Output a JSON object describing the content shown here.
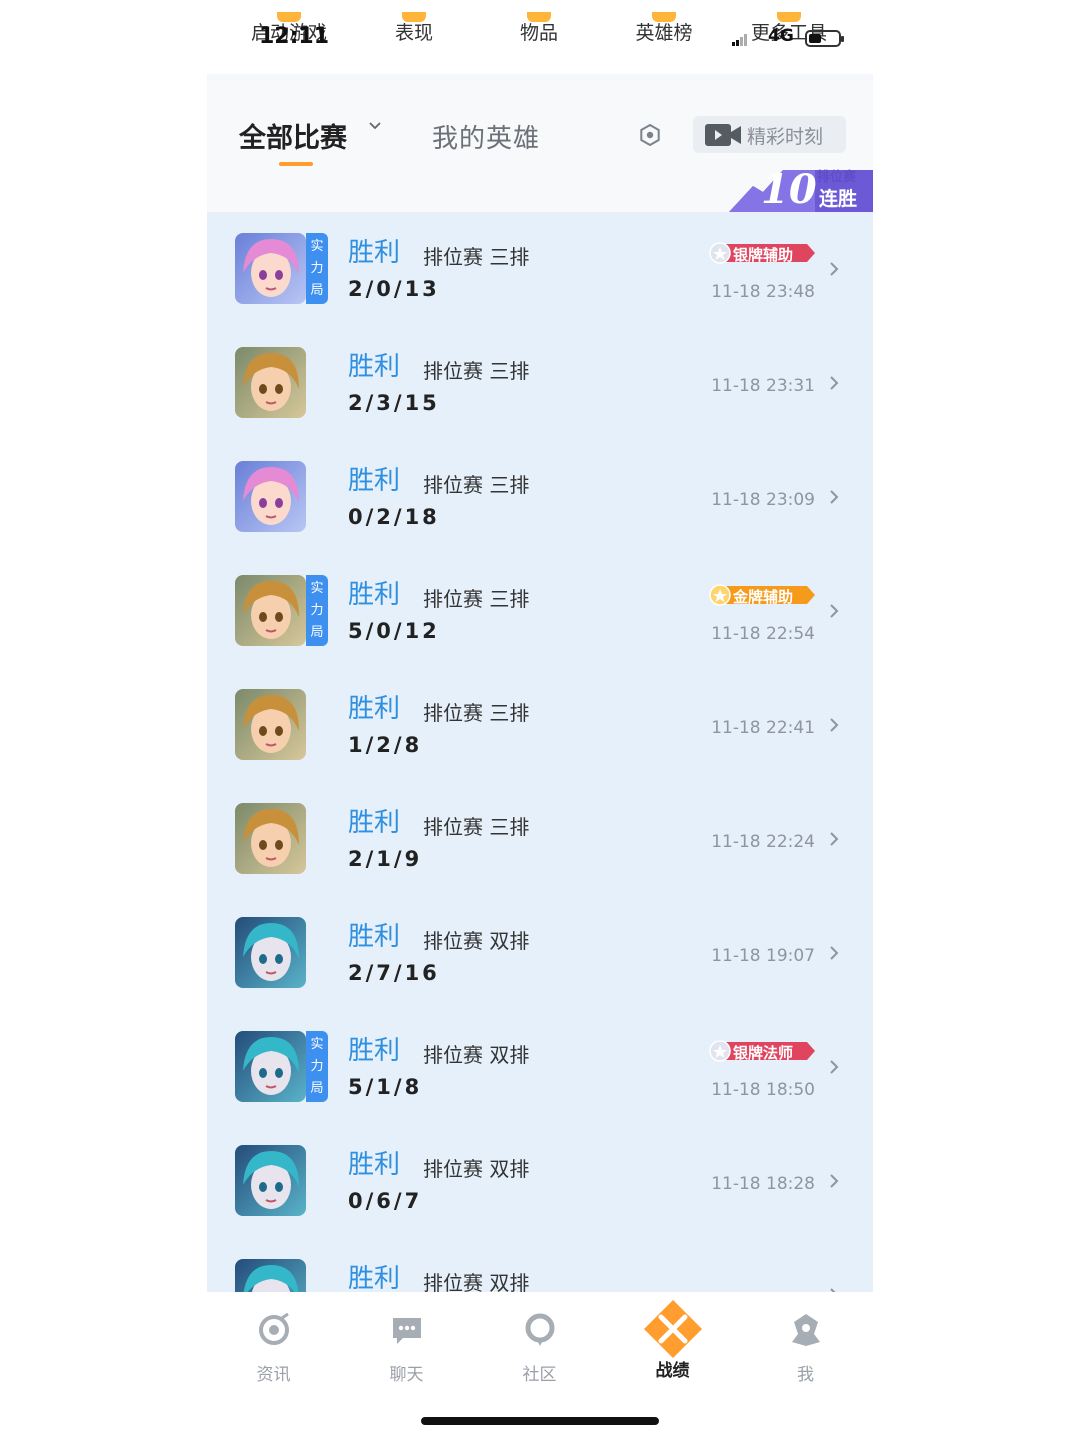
{
  "status_bar": {
    "time": "12:11",
    "network": "4G"
  },
  "top_nav": {
    "items": [
      {
        "label": "启动游戏"
      },
      {
        "label": "表现"
      },
      {
        "label": "物品"
      },
      {
        "label": "英雄榜"
      },
      {
        "label": "更多工具"
      }
    ],
    "accent": "#ffb43a"
  },
  "filter": {
    "all_matches": "全部比赛",
    "my_heroes": "我的英雄",
    "highlights": "精彩时刻",
    "streak": {
      "count": "10",
      "rank_label": "排位赛",
      "label": "连胜"
    }
  },
  "matches": [
    {
      "hero": "pink-hair-hero",
      "strength_tag": "实力局",
      "result": "胜利",
      "mode": "排位赛 三排",
      "kda": "2/0/13",
      "medal": "银牌辅助",
      "medal_tier": "silver",
      "time": "11-18 23:48"
    },
    {
      "hero": "blonde-hero",
      "strength_tag": "",
      "result": "胜利",
      "mode": "排位赛 三排",
      "kda": "2/3/15",
      "medal": "",
      "medal_tier": "",
      "time": "11-18 23:31"
    },
    {
      "hero": "pink-hair-hero",
      "strength_tag": "",
      "result": "胜利",
      "mode": "排位赛 三排",
      "kda": "0/2/18",
      "medal": "",
      "medal_tier": "",
      "time": "11-18 23:09"
    },
    {
      "hero": "blonde-hero",
      "strength_tag": "实力局",
      "result": "胜利",
      "mode": "排位赛 三排",
      "kda": "5/0/12",
      "medal": "金牌辅助",
      "medal_tier": "gold",
      "time": "11-18 22:54"
    },
    {
      "hero": "blonde-hero",
      "strength_tag": "",
      "result": "胜利",
      "mode": "排位赛 三排",
      "kda": "1/2/8",
      "medal": "",
      "medal_tier": "",
      "time": "11-18 22:41"
    },
    {
      "hero": "blonde-hero",
      "strength_tag": "",
      "result": "胜利",
      "mode": "排位赛 三排",
      "kda": "2/1/9",
      "medal": "",
      "medal_tier": "",
      "time": "11-18 22:24"
    },
    {
      "hero": "teal-hair-hero",
      "strength_tag": "",
      "result": "胜利",
      "mode": "排位赛 双排",
      "kda": "2/7/16",
      "medal": "",
      "medal_tier": "",
      "time": "11-18 19:07"
    },
    {
      "hero": "teal-hair-hero",
      "strength_tag": "实力局",
      "result": "胜利",
      "mode": "排位赛 双排",
      "kda": "5/1/8",
      "medal": "银牌法师",
      "medal_tier": "silver",
      "time": "11-18 18:50"
    },
    {
      "hero": "teal-hair-hero",
      "strength_tag": "",
      "result": "胜利",
      "mode": "排位赛 双排",
      "kda": "0/6/7",
      "medal": "",
      "medal_tier": "",
      "time": "11-18 18:28"
    },
    {
      "hero": "teal-hair-hero",
      "strength_tag": "",
      "result": "胜利",
      "mode": "排位赛 双排",
      "kda": "",
      "medal": "",
      "medal_tier": "",
      "time": ""
    }
  ],
  "tab_bar": {
    "items": [
      {
        "label": "资讯",
        "icon": "news-icon"
      },
      {
        "label": "聊天",
        "icon": "chat-icon"
      },
      {
        "label": "社区",
        "icon": "community-icon"
      },
      {
        "label": "战绩",
        "icon": "record-icon"
      },
      {
        "label": "我",
        "icon": "profile-icon"
      }
    ],
    "active": "战绩",
    "active_color": "#ff9d2e"
  },
  "colors": {
    "result_win": "#2f8fe0",
    "strength_tag": "#3d8ff0",
    "medal_silver": "#e0455f",
    "medal_gold": "#f59a1b"
  }
}
